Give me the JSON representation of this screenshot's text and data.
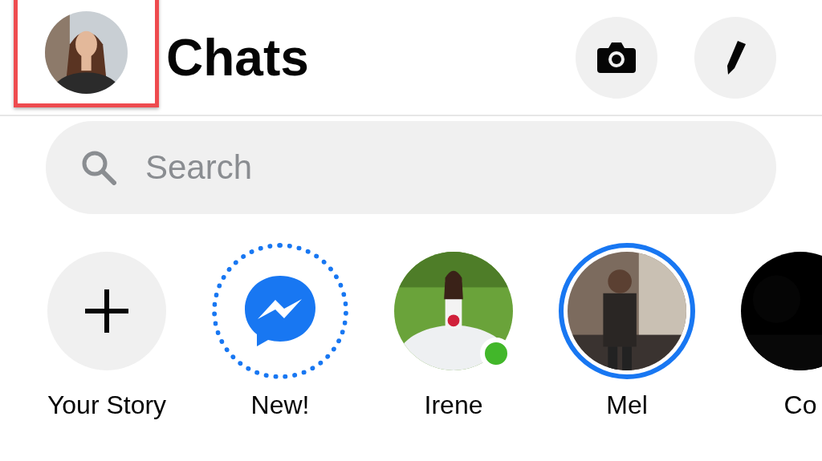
{
  "header": {
    "profile": {
      "kind": "picture",
      "highlighted": true
    },
    "title": "Chats",
    "actions": [
      {
        "kind": "camera"
      },
      {
        "kind": "compose"
      }
    ]
  },
  "search": {
    "placeholder": "Search"
  },
  "stories": [
    {
      "kind": "add",
      "label": "Your Story",
      "online": false,
      "unseen": false
    },
    {
      "kind": "new",
      "label": "New!",
      "online": false,
      "unseen": false
    },
    {
      "kind": "contact",
      "label": "Irene",
      "online": true,
      "unseen": false
    },
    {
      "kind": "contact",
      "label": "Mel",
      "online": false,
      "unseen": true
    },
    {
      "kind": "contact",
      "label": "Co",
      "online": false,
      "unseen": false
    }
  ]
}
